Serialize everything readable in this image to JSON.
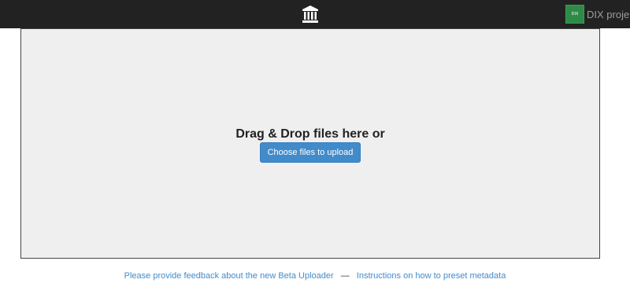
{
  "topbar": {
    "logo_icon": "institution-icon",
    "project": {
      "thumb_label": "DIX",
      "label": "DIX proje...",
      "thumb_color": "#2e8b47"
    }
  },
  "dropzone": {
    "title": "Drag & Drop files here or",
    "button_label": "Choose files to upload"
  },
  "footer": {
    "feedback_link": "Please provide feedback about the new Beta Uploader",
    "separator": "—",
    "instructions_link": "Instructions on how to preset metadata"
  },
  "colors": {
    "topbar": "#222222",
    "accent": "#428bca",
    "dropzone_bg": "#efefef"
  }
}
